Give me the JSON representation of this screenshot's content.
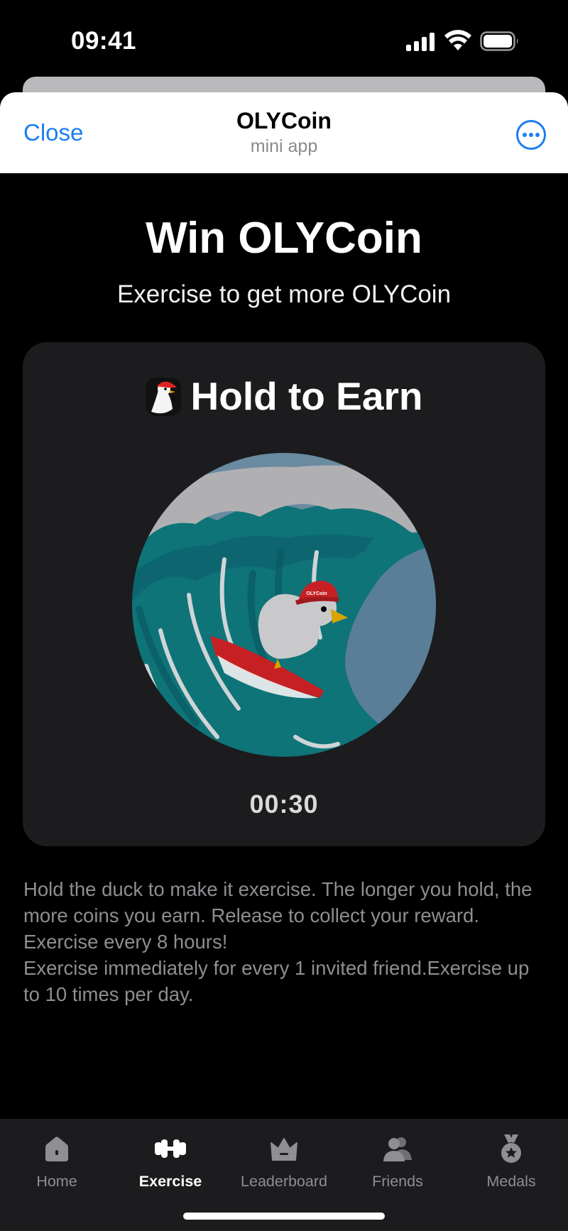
{
  "status_bar": {
    "time": "09:41"
  },
  "header": {
    "close_label": "Close",
    "title": "OLYCoin",
    "subtitle": "mini app"
  },
  "main": {
    "title": "Win OLYCoin",
    "subtitle": "Exercise to get more OLYCoin",
    "card": {
      "title": "Hold to Earn",
      "timer": "00:30",
      "hat_text": "OLYCoin"
    },
    "instructions": [
      "Hold the duck to make it exercise. The longer you hold, the more coins you earn. Release to collect your reward. Exercise every 8 hours!",
      "Exercise immediately for every 1 invited friend.Exercise up to 10 times per day."
    ]
  },
  "tabs": [
    {
      "label": "Home",
      "icon": "home-icon",
      "active": false
    },
    {
      "label": "Exercise",
      "icon": "dumbbell-icon",
      "active": true
    },
    {
      "label": "Leaderboard",
      "icon": "crown-icon",
      "active": false
    },
    {
      "label": "Friends",
      "icon": "friends-icon",
      "active": false
    },
    {
      "label": "Medals",
      "icon": "medal-icon",
      "active": false
    }
  ],
  "colors": {
    "accent": "#1a7ff0",
    "background": "#000000",
    "card": "#1c1c1e",
    "muted_text": "#8e8e93"
  }
}
